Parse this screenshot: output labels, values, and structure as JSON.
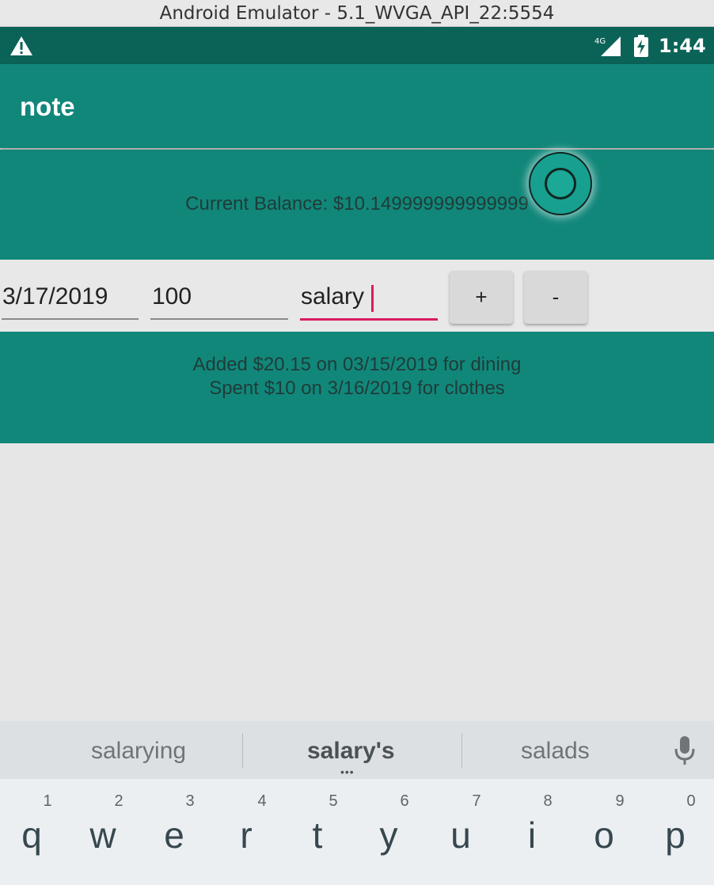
{
  "window": {
    "title": "Android Emulator - 5.1_WVGA_API_22:5554"
  },
  "status_bar": {
    "time": "1:44",
    "network": "4G"
  },
  "app_bar": {
    "title": "note"
  },
  "balance": {
    "text": "Current Balance: $10.149999999999999"
  },
  "form": {
    "date_value": "3/17/2019",
    "amount_value": "100",
    "note_value": "salary",
    "add_label": "+",
    "subtract_label": "-"
  },
  "history": [
    "Added $20.15 on 03/15/2019 for dining",
    "Spent $10 on 3/16/2019 for clothes"
  ],
  "keyboard": {
    "suggestions": [
      "salarying",
      "salary's",
      "salads"
    ],
    "keys": [
      {
        "hint": "1",
        "char": "q"
      },
      {
        "hint": "2",
        "char": "w"
      },
      {
        "hint": "3",
        "char": "e"
      },
      {
        "hint": "4",
        "char": "r"
      },
      {
        "hint": "5",
        "char": "t"
      },
      {
        "hint": "6",
        "char": "y"
      },
      {
        "hint": "7",
        "char": "u"
      },
      {
        "hint": "8",
        "char": "i"
      },
      {
        "hint": "9",
        "char": "o"
      },
      {
        "hint": "0",
        "char": "p"
      }
    ]
  },
  "colors": {
    "status_bar": "#0b6358",
    "primary": "#11877a",
    "accent": "#d81b60"
  },
  "icons": [
    "warning-icon",
    "signal-icon",
    "battery-icon",
    "mic-icon"
  ]
}
